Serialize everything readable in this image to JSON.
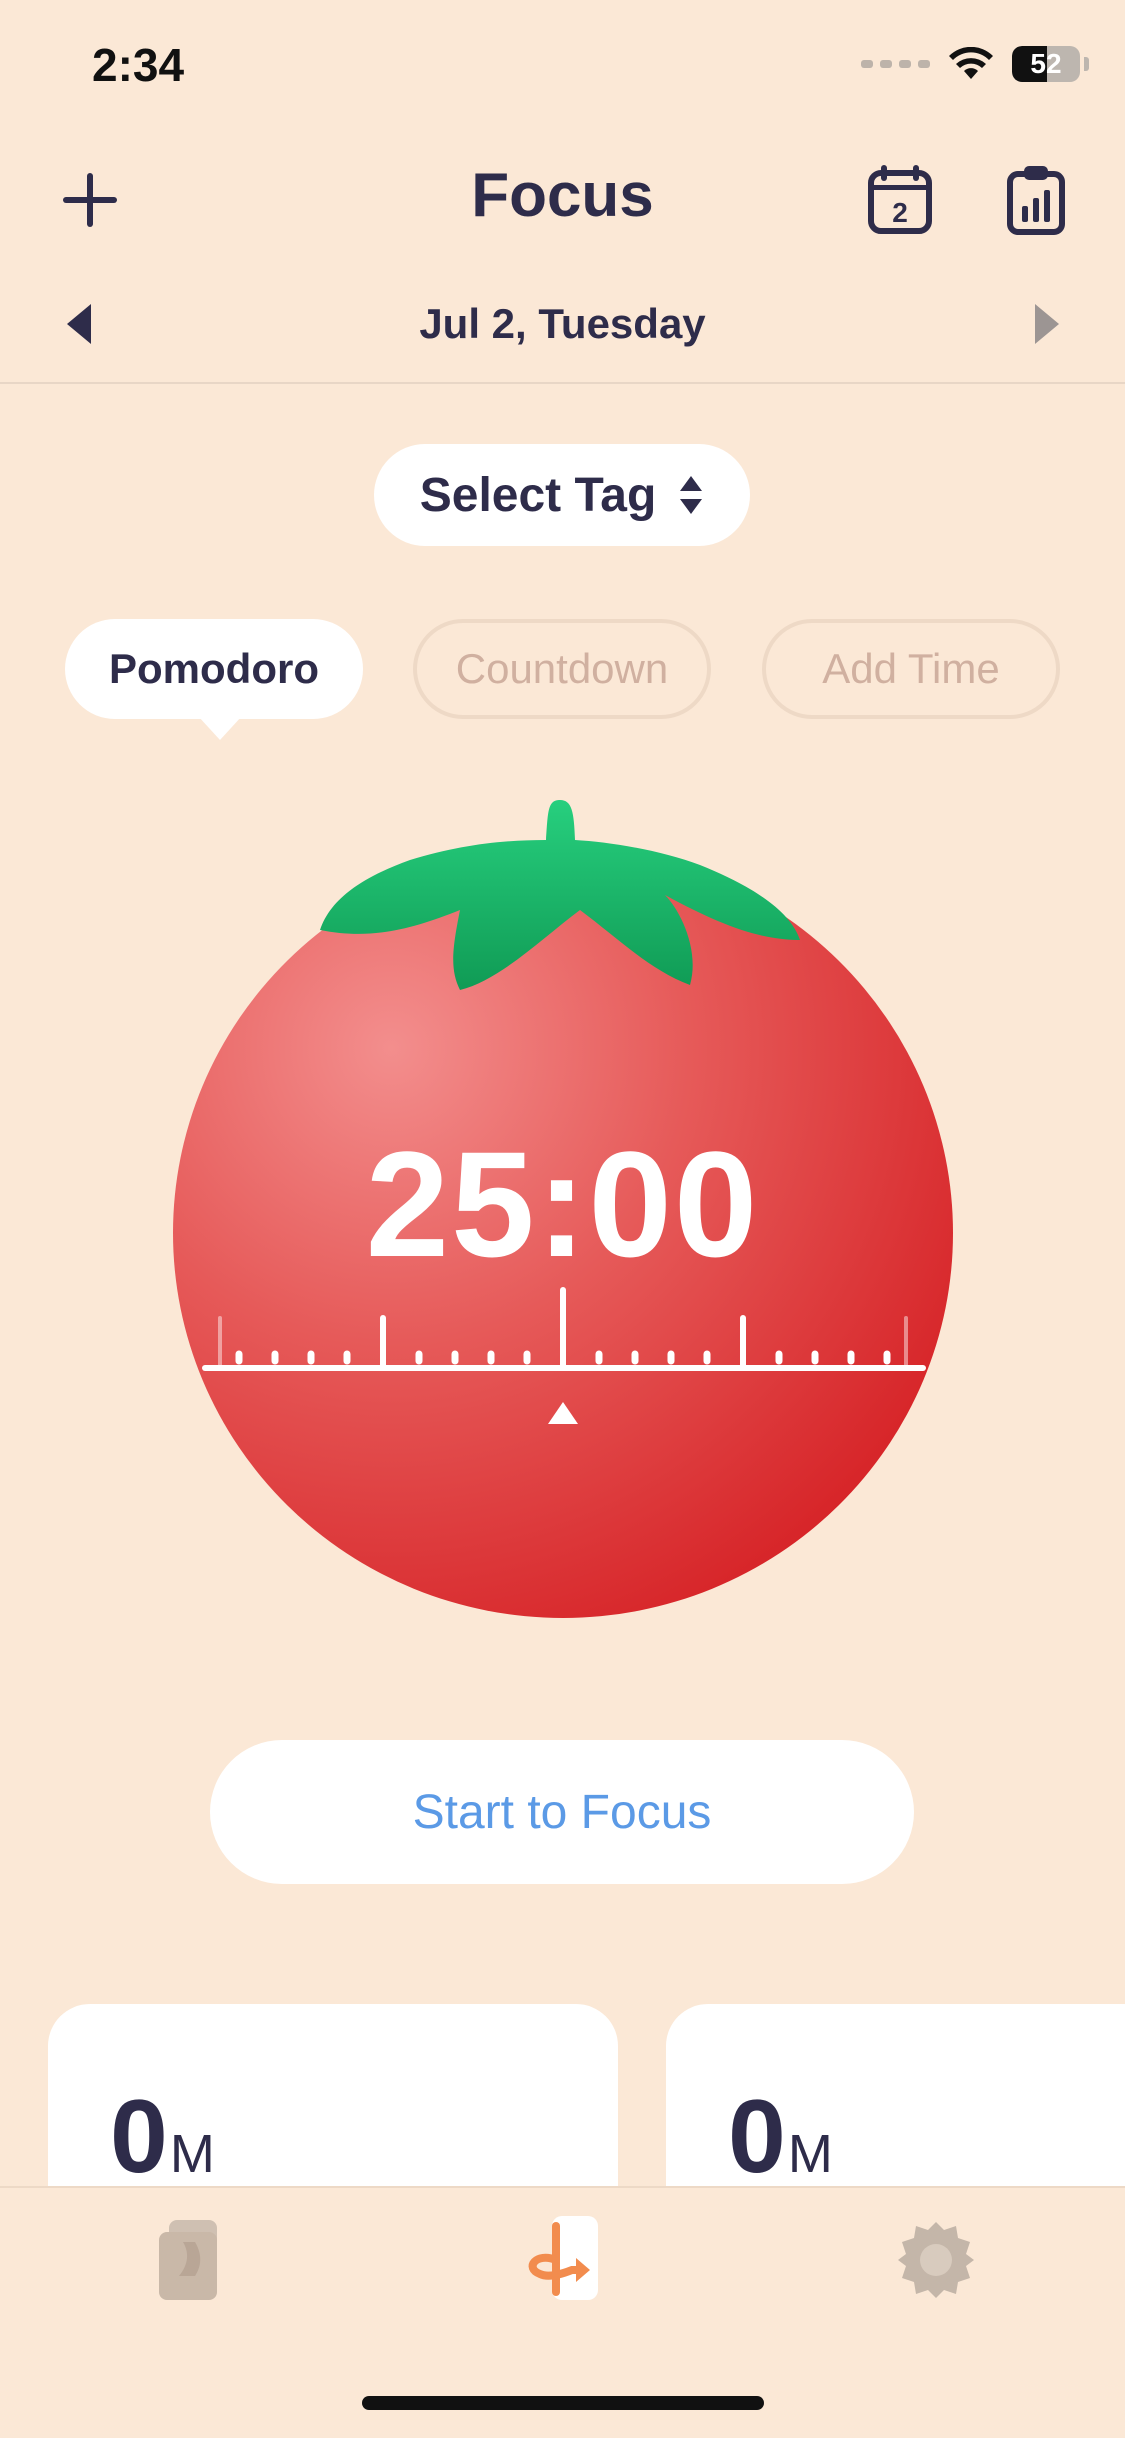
{
  "status": {
    "time": "2:34",
    "battery": "52"
  },
  "header": {
    "title": "Focus",
    "calendar_badge": "2"
  },
  "date": {
    "label": "Jul 2, Tuesday"
  },
  "tag": {
    "label": "Select Tag"
  },
  "modes": [
    {
      "label": "Pomodoro",
      "active": true
    },
    {
      "label": "Countdown",
      "active": false
    },
    {
      "label": "Add Time",
      "active": false
    }
  ],
  "timer": {
    "display": "25:00"
  },
  "actions": {
    "start_label": "Start to Focus"
  },
  "stats": [
    {
      "value": "0",
      "unit": "M"
    },
    {
      "value": "0",
      "unit": "M"
    }
  ],
  "tabs": [
    {
      "icon": "cards-icon",
      "active": false
    },
    {
      "icon": "focus-timer-icon",
      "active": true
    },
    {
      "icon": "settings-gear-icon",
      "active": false
    }
  ],
  "colors": {
    "background": "#FBE8D6",
    "primary_text": "#2E2C4A",
    "tomato": "#E0383A",
    "leaf": "#1FB56A",
    "accent_blue": "#5B9AE6",
    "accent_orange": "#F28C4E"
  }
}
